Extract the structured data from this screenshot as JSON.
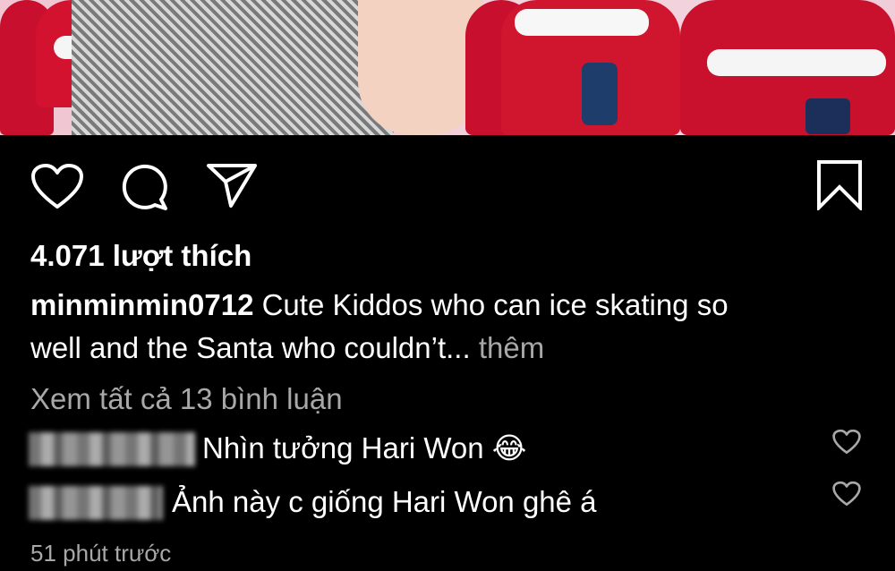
{
  "post": {
    "likes": "4.071 lượt thích",
    "username": "minminmin0712",
    "caption_line1": "Cute Kiddos who can ice skating so",
    "caption_line2": "well and the Santa who couldn’t...",
    "more_label": "thêm",
    "view_all_comments": "Xem tất cả 13 bình luận",
    "timestamp": "51 phút trước"
  },
  "comments": [
    {
      "text": "Nhìn tưởng Hari Won 😂"
    },
    {
      "text": "Ảnh  này c giống Hari Won ghê á"
    }
  ],
  "icons": {
    "like": "heart-icon",
    "comment": "comment-icon",
    "share": "send-icon",
    "save": "bookmark-icon"
  },
  "colors": {
    "background": "#000000",
    "text": "#ffffff",
    "secondary_text": "#a8a8a8"
  }
}
